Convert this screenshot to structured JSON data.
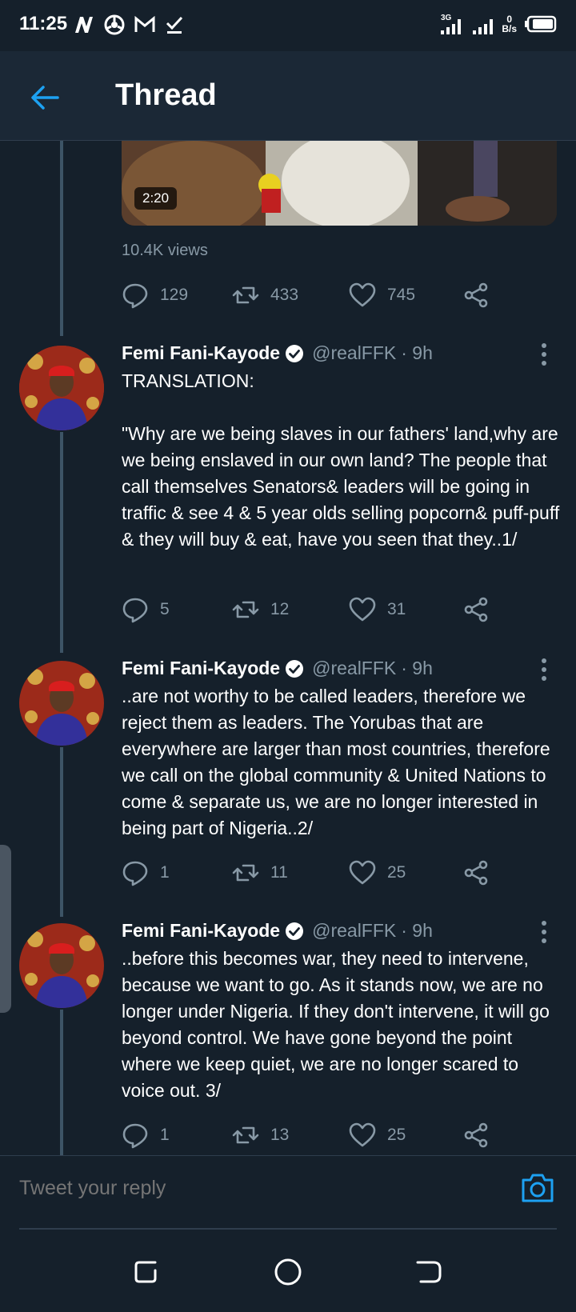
{
  "status_bar": {
    "time": "11:25",
    "network_label": "3G",
    "net_speed_value": "0",
    "net_speed_unit": "B/s"
  },
  "header": {
    "title": "Thread"
  },
  "video": {
    "duration": "2:20",
    "views": "10.4K views"
  },
  "first_actions": {
    "replies": "129",
    "retweets": "433",
    "likes": "745"
  },
  "tweets": [
    {
      "name": "Femi Fani-Kayode",
      "handle": "@realFFK",
      "time": "· 9h",
      "text": "TRANSLATION:\n\n\"Why are we being slaves in our fathers' land,why are we being enslaved in our own land? The people that call themselves Senators& leaders will be going in traffic & see 4 & 5 year olds selling popcorn& puff-puff & they will buy & eat, have you seen that they..1/",
      "replies": "5",
      "retweets": "12",
      "likes": "31"
    },
    {
      "name": "Femi Fani-Kayode",
      "handle": "@realFFK",
      "time": "· 9h",
      "text": "..are not worthy to be called leaders, therefore we reject them as leaders. The Yorubas that are everywhere are larger than most countries, therefore we call on the global community & United Nations to come & separate us, we are no longer interested in being part of Nigeria..2/",
      "replies": "1",
      "retweets": "11",
      "likes": "25"
    },
    {
      "name": "Femi Fani-Kayode",
      "handle": "@realFFK",
      "time": "· 9h",
      "text": "..before this becomes war, they need to intervene, because we want to go. As it stands now, we are no longer under Nigeria. If they don't intervene, it will go beyond control. We have gone beyond the point where we keep quiet, we are no longer scared to voice out. 3/",
      "replies": "1",
      "retweets": "13",
      "likes": "25"
    }
  ],
  "reply": {
    "placeholder": "Tweet your reply"
  },
  "icons": {
    "back": "back-arrow-icon",
    "reply": "comment-icon",
    "retweet": "retweet-icon",
    "like": "heart-icon",
    "share": "share-icon",
    "verified": "verified-badge-icon",
    "more": "more-vertical-icon",
    "camera": "camera-icon"
  },
  "colors": {
    "background": "#15202b",
    "accent": "#1da1f2",
    "muted_text": "#8899a6"
  }
}
